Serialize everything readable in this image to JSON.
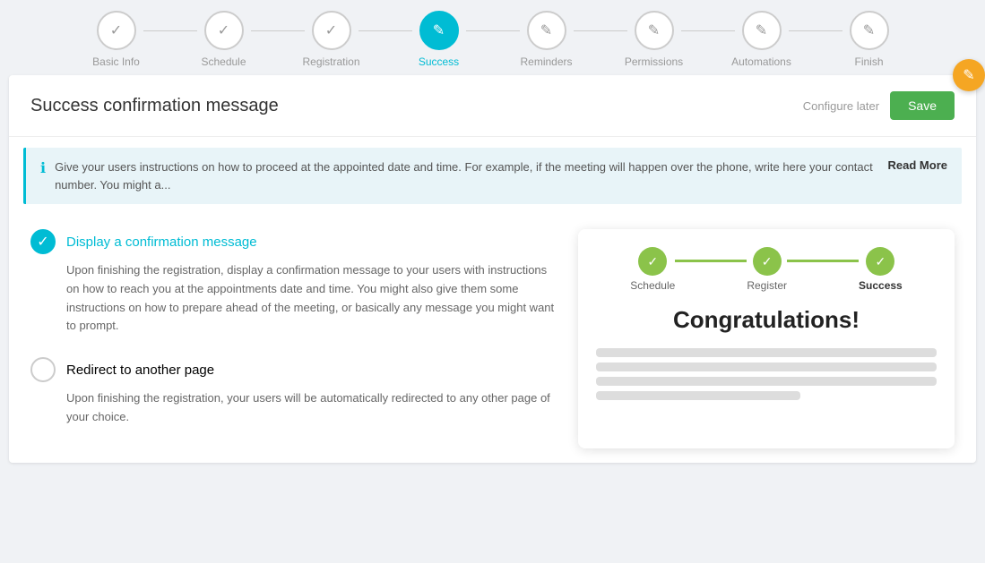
{
  "nav": {
    "steps": [
      {
        "id": "basic-info",
        "label": "Basic Info",
        "state": "completed",
        "icon": "✓"
      },
      {
        "id": "schedule",
        "label": "Schedule",
        "state": "completed",
        "icon": "✓"
      },
      {
        "id": "registration",
        "label": "Registration",
        "state": "completed",
        "icon": "✓"
      },
      {
        "id": "success",
        "label": "Success",
        "state": "active",
        "icon": "✎"
      },
      {
        "id": "reminders",
        "label": "Reminders",
        "state": "default",
        "icon": "✎"
      },
      {
        "id": "permissions",
        "label": "Permissions",
        "state": "default",
        "icon": "✎"
      },
      {
        "id": "automations",
        "label": "Automations",
        "state": "default",
        "icon": "✎"
      },
      {
        "id": "finish",
        "label": "Finish",
        "state": "default",
        "icon": "✎"
      }
    ]
  },
  "header": {
    "title": "Success confirmation message",
    "configure_later": "Configure later",
    "save": "Save"
  },
  "info_bar": {
    "text": "Give your users instructions on how to proceed at the appointed date and time. For example, if the meeting will happen over the phone, write here your contact number. You might a...",
    "read_more": "Read More"
  },
  "options": [
    {
      "id": "display-confirmation",
      "title": "Display a confirmation message",
      "checked": true,
      "description": "Upon finishing the registration, display a confirmation message to your users with instructions on how to reach you at the appointments date and time. You might also give them some instructions on how to prepare ahead of the meeting, or basically any message you might want to prompt."
    },
    {
      "id": "redirect-page",
      "title": "Redirect to another page",
      "checked": false,
      "description": "Upon finishing the registration, your users will be automatically redirected to any other page of your choice."
    }
  ],
  "preview": {
    "steps": [
      {
        "label": "Schedule",
        "bold": false
      },
      {
        "label": "Register",
        "bold": false
      },
      {
        "label": "Success",
        "bold": true
      }
    ],
    "congrats": "Congratulations!",
    "lines": [
      100,
      100,
      100,
      60
    ]
  },
  "fab": {
    "icon": "✎"
  }
}
